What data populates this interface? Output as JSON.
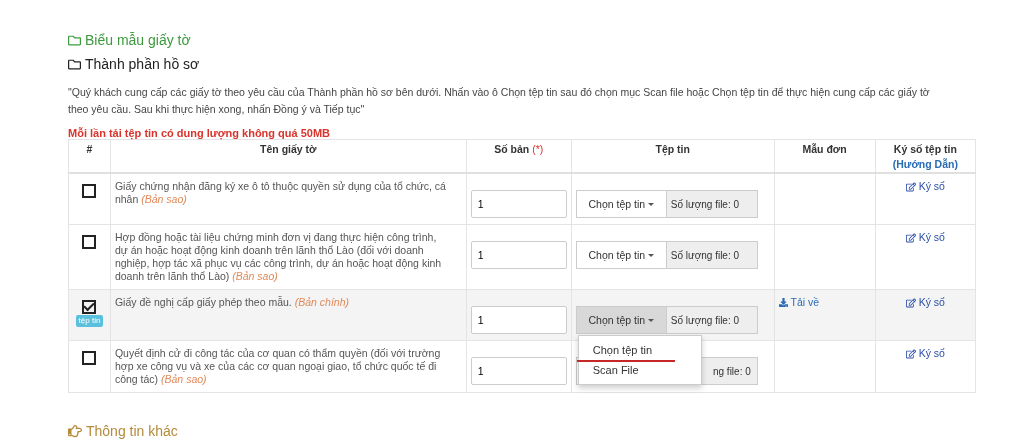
{
  "sections": [
    {
      "title": "Biểu mẫu giấy tờ",
      "kind": "link"
    },
    {
      "title": "Thành phần hồ sơ",
      "kind": "heading"
    }
  ],
  "instructions": "\"Quý khách cung cấp các giấy tờ theo yêu cầu của Thành phần hồ sơ bên dưới. Nhấn vào ô Chọn tệp tin sau đó chọn mục Scan file hoặc Chọn tệp tin để thực hiện cung cấp các giấy tờ theo yêu cầu. Sau khi thực hiện xong, nhấn Đồng ý và Tiếp tục\"",
  "size_warning": "Mỗi lần tải tệp tin có dung lượng không quá 50MB",
  "table": {
    "columns": [
      {
        "label": "#"
      },
      {
        "label": "Tên giấy tờ"
      },
      {
        "label": "Số bản",
        "required_mark": "(*)"
      },
      {
        "label": "Tệp tin"
      },
      {
        "label": "Mẫu đơn"
      },
      {
        "label": "Ký số tệp tin",
        "link": "(Hướng Dẫn)"
      }
    ],
    "rows": [
      {
        "checked": false,
        "name": "Giấy chứng nhận đăng ký xe ô tô thuộc quyền sử dụng của tổ chức, cá nhân *(Bản sao)*",
        "copies": "1",
        "choose_label": "Chọn tệp tin",
        "file_count": "Số lượng file: 0",
        "sign": "Ký số"
      },
      {
        "checked": false,
        "name": "Hợp đồng hoặc tài liệu chứng minh đơn vị đang thực hiện công trình, dự án hoặc hoạt động kinh doanh trên lãnh thổ Lào (đối với doanh nghiệp, hợp tác xã phục vụ các công trình, dự án hoặc hoạt động kinh doanh trên lãnh thổ Lào) *(Bản sao)*",
        "copies": "1",
        "choose_label": "Chọn tệp tin",
        "file_count": "Số lượng file: 0",
        "sign": "Ký số"
      },
      {
        "checked": true,
        "badge": "tệp tin",
        "name": "Giấy đề nghị cấp giấy phép theo mẫu. *(Bản chính)*",
        "copies": "1",
        "choose_label": "Chọn tệp tin",
        "file_count": "Số lượng file: 0",
        "template": "Tải về",
        "sign": "Ký số",
        "menu": [
          {
            "label": "Chọn tệp tin",
            "underlined": true
          },
          {
            "label": "Scan File",
            "underlined": false
          }
        ]
      },
      {
        "checked": false,
        "name": "Quyết định cử đi công tác của cơ quan có thẩm quyền (đối với trường hợp xe công vụ và xe của các cơ quan ngoại giao, tổ chức quốc tế đi công tác) *(Bản sao)*",
        "copies": "1",
        "file_count": "ng file: 0",
        "sign": "Ký số"
      }
    ]
  },
  "footer_section": "Thông tin khác"
}
